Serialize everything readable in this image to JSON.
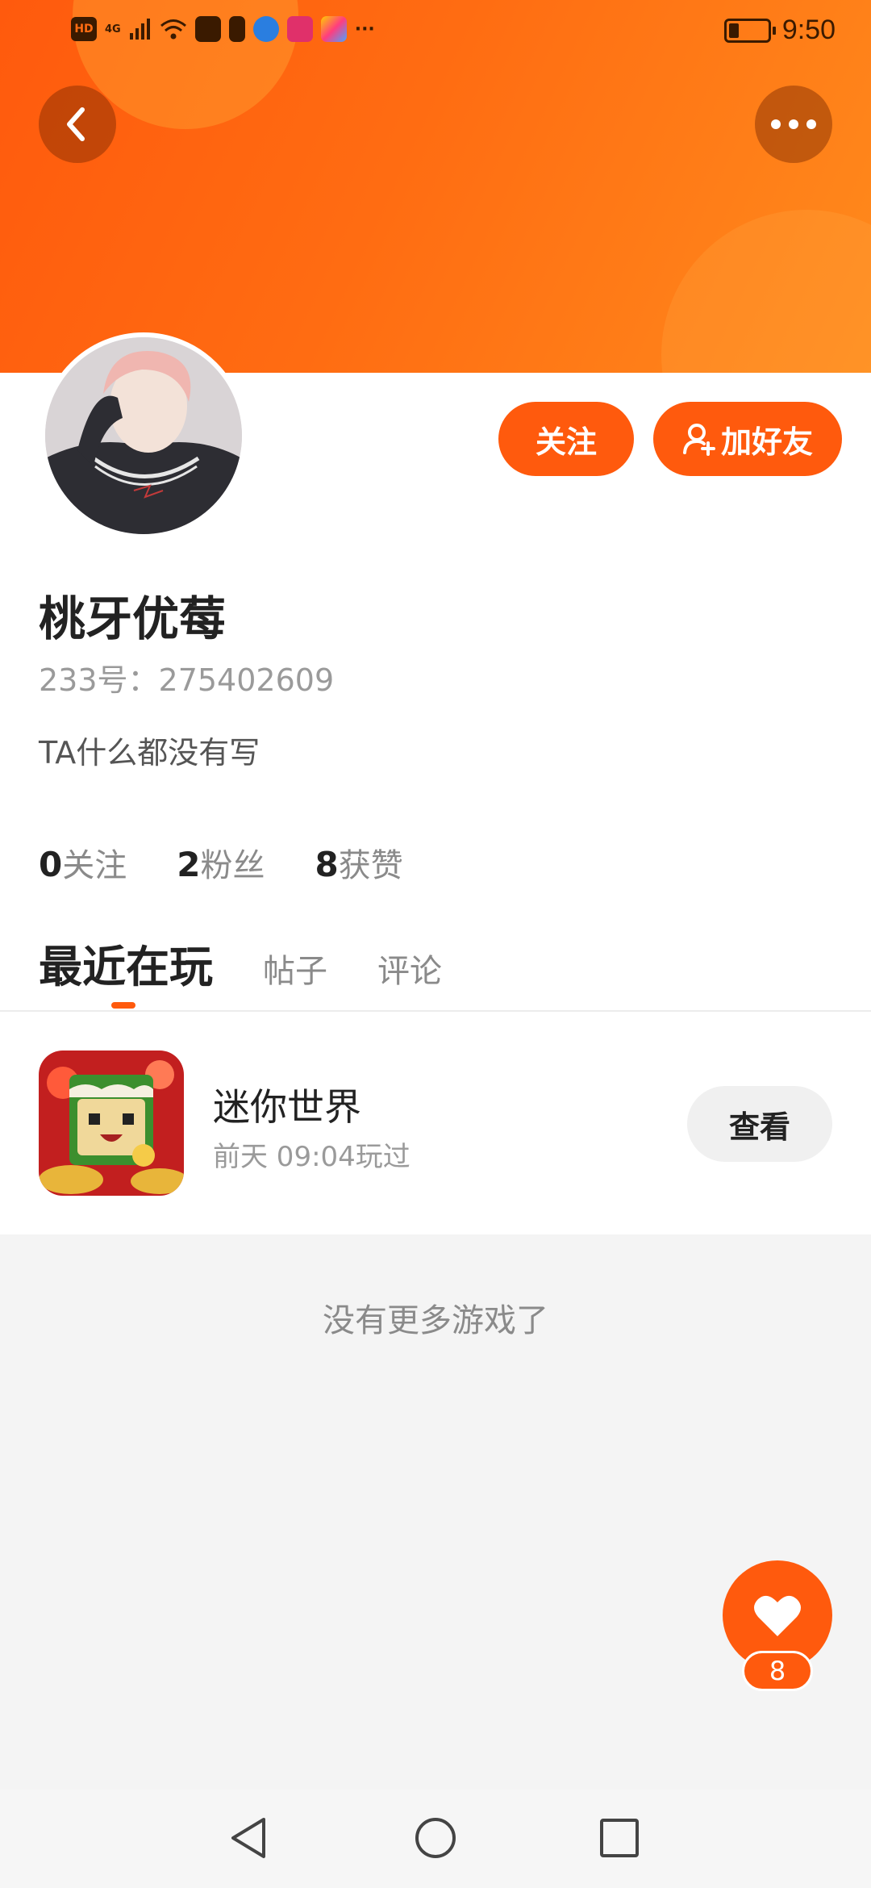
{
  "status_bar": {
    "time": "9:50",
    "network": "4G",
    "hd_label": "HD",
    "more": "···"
  },
  "header": {
    "back_icon": "chevron-left-icon",
    "more_icon": "more-dots-icon"
  },
  "actions": {
    "follow_label": "关注",
    "add_friend_label": "加好友"
  },
  "profile": {
    "name": "桃牙优莓",
    "id_text": "233号：275402609",
    "bio": "TA什么都没有写",
    "stats": [
      {
        "num": "0",
        "label": "关注"
      },
      {
        "num": "2",
        "label": "粉丝"
      },
      {
        "num": "8",
        "label": "获赞"
      }
    ]
  },
  "tabs": [
    {
      "label": "最近在玩",
      "active": true
    },
    {
      "label": "帖子",
      "active": false
    },
    {
      "label": "评论",
      "active": false
    }
  ],
  "games": [
    {
      "name": "迷你世界",
      "subtitle": "前天 09:04玩过",
      "button": "查看"
    }
  ],
  "footer_text": "没有更多游戏了",
  "like_fab": {
    "count": "8",
    "icon": "heart-icon"
  },
  "colors": {
    "accent": "#ff5a0d",
    "banner_end": "#ff8a1c"
  }
}
